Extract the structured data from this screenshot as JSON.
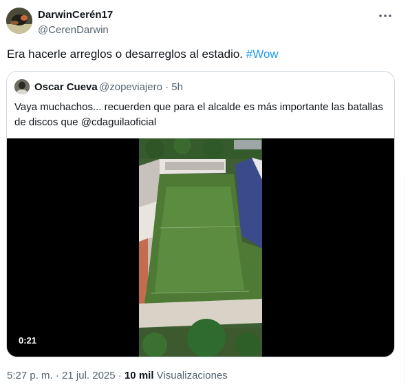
{
  "tweet": {
    "author_name": "DarwinCerén17",
    "author_handle": "@CerenDarwin",
    "text": "Era hacerle arreglos o desarreglos al estadio.",
    "hashtag": "#Wow",
    "more_icon": "more-icon"
  },
  "quote": {
    "author_name": "Oscar Cueva",
    "author_handle": "@zopeviajero",
    "separator": " · ",
    "time": "5h",
    "text": "Vaya muchachos... recuerden que para el alcalde es más importante las batallas de discos que @cdaguilaoficial",
    "video_duration": "0:21"
  },
  "footer": {
    "time": "5:27 p. m.",
    "separator": " · ",
    "date": "21 jul. 2025",
    "separator2": " · ",
    "views_count": "10 mil",
    "views_label": "Visualizaciones"
  }
}
